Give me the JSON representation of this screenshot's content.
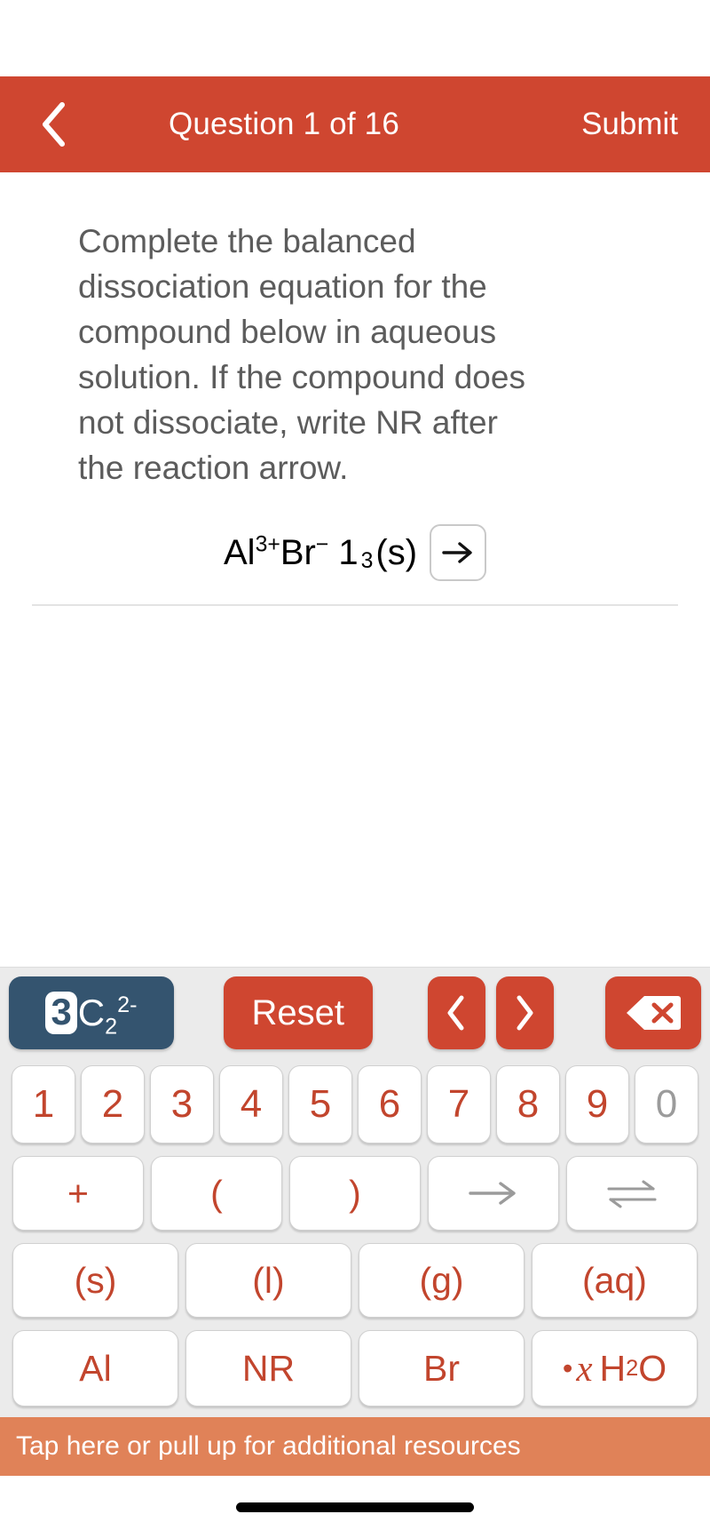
{
  "header": {
    "back_icon": "chevron-left-icon",
    "title": "Question 1 of 16",
    "submit_label": "Submit",
    "bg_color": "#cf4630"
  },
  "question": {
    "text": "Complete the balanced dissociation equation for the compound below in aqueous solution. If the compound does not dissociate, write NR after the reaction arrow.",
    "text_color": "#5c5c5c"
  },
  "equation": {
    "parts": {
      "al": "Al",
      "al_charge": "3+",
      "br": "Br",
      "br_charge": "−",
      "coefficient": "1",
      "subscript": "3",
      "state": "(s)"
    },
    "plain": "Al3+Br− 1 3(s)",
    "cursor_icon": "right-arrow-icon"
  },
  "keyboard": {
    "toolbar": {
      "token_highlight": "3",
      "token_element": "C",
      "token_subscript": "2",
      "token_charge": "2-",
      "token_bg": "#34546f",
      "reset_label": "Reset",
      "prev_icon": "chevron-left-icon",
      "next_icon": "chevron-right-icon",
      "delete_icon": "backspace-delete-icon",
      "button_bg": "#cf4630"
    },
    "number_row": [
      {
        "label": "1",
        "disabled": false
      },
      {
        "label": "2",
        "disabled": false
      },
      {
        "label": "3",
        "disabled": false
      },
      {
        "label": "4",
        "disabled": false
      },
      {
        "label": "5",
        "disabled": false
      },
      {
        "label": "6",
        "disabled": false
      },
      {
        "label": "7",
        "disabled": false
      },
      {
        "label": "8",
        "disabled": false
      },
      {
        "label": "9",
        "disabled": false
      },
      {
        "label": "0",
        "disabled": true
      }
    ],
    "operator_row": [
      {
        "label": "+",
        "type": "text",
        "disabled": false
      },
      {
        "label": "(",
        "type": "text",
        "disabled": false
      },
      {
        "label": ")",
        "type": "text",
        "disabled": false
      },
      {
        "label": "→",
        "type": "icon",
        "icon": "reaction-arrow-icon",
        "disabled": true
      },
      {
        "label": "⇌",
        "type": "icon",
        "icon": "equilibrium-arrow-icon",
        "disabled": true
      }
    ],
    "state_row": [
      {
        "label": "(s)",
        "disabled": false
      },
      {
        "label": "(l)",
        "disabled": false
      },
      {
        "label": "(g)",
        "disabled": false
      },
      {
        "label": "(aq)",
        "disabled": false
      }
    ],
    "element_row": [
      {
        "label": "Al",
        "disabled": false
      },
      {
        "label": "NR",
        "disabled": false
      },
      {
        "label": "Br",
        "disabled": false
      },
      {
        "label": "· x H2O",
        "disabled": false,
        "type": "hydrate"
      }
    ],
    "hydrate": {
      "dot": "•",
      "variable": "x",
      "formula_h": "H",
      "formula_sub": "2",
      "formula_o": "O"
    },
    "key_text_color": "#c2452d",
    "key_disabled_color": "#9b9b9b",
    "bg_color": "#ebebeb"
  },
  "resources_bar": {
    "label": "Tap here or pull up for additional resources",
    "bg_color": "#e08258"
  }
}
